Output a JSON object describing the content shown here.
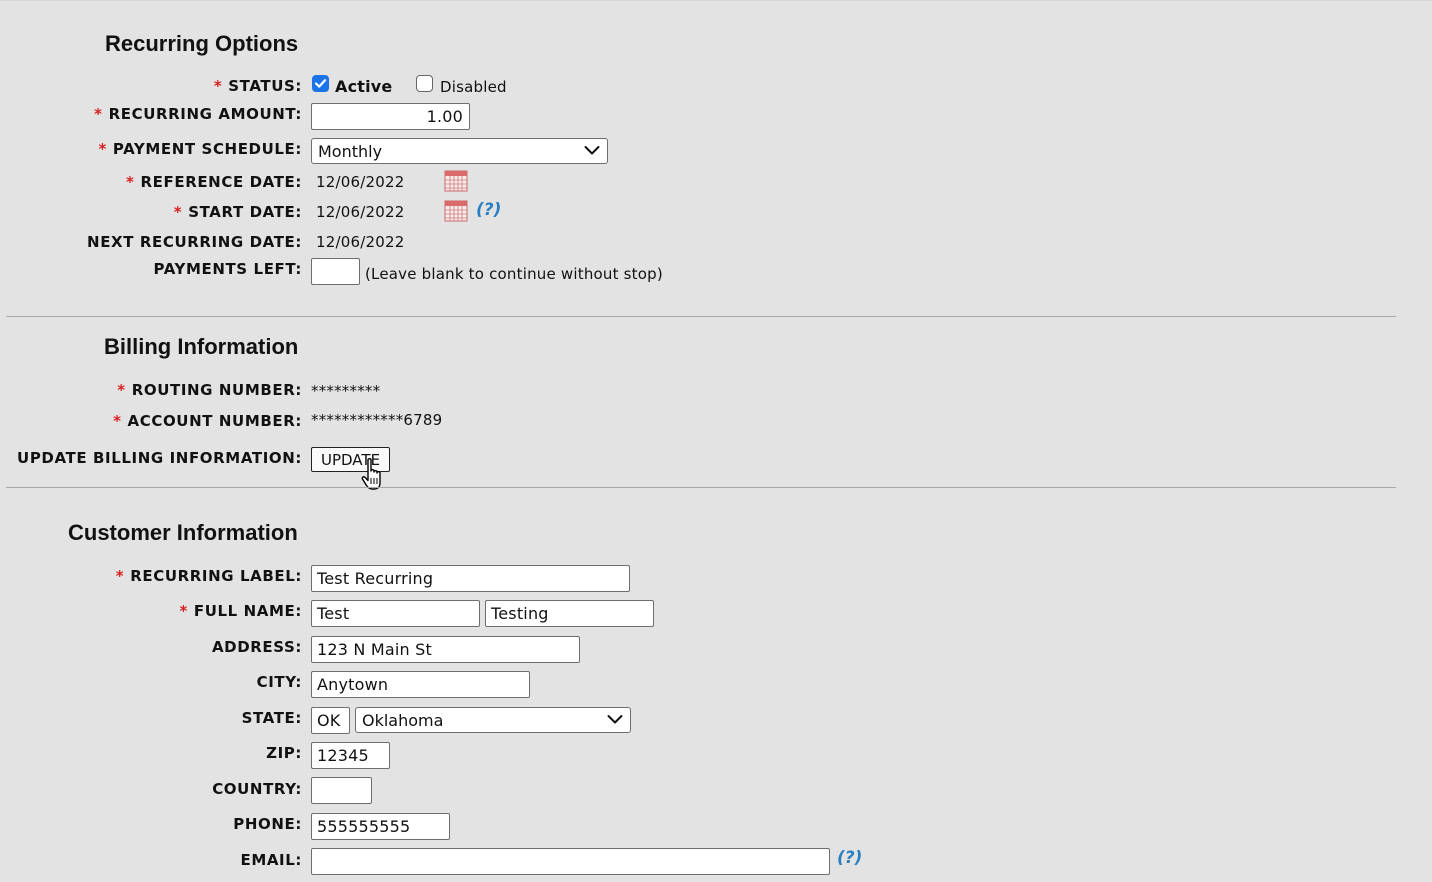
{
  "recurring": {
    "heading": "Recurring Options",
    "status": {
      "label": "STATUS:",
      "active_label": "Active",
      "active_checked": true,
      "disabled_label": "Disabled",
      "disabled_checked": false
    },
    "amount": {
      "label": "RECURRING AMOUNT:",
      "value": "1.00"
    },
    "schedule": {
      "label": "PAYMENT SCHEDULE:",
      "value": "Monthly"
    },
    "reference_date": {
      "label": "REFERENCE DATE:",
      "value": "12/06/2022"
    },
    "start_date": {
      "label": "START DATE:",
      "value": "12/06/2022",
      "help": "(?)"
    },
    "next_date": {
      "label": "NEXT RECURRING DATE:",
      "value": "12/06/2022"
    },
    "payments_left": {
      "label": "PAYMENTS LEFT:",
      "value": "",
      "hint": "(Leave blank to continue without stop)"
    }
  },
  "billing": {
    "heading": "Billing Information",
    "routing": {
      "label": "ROUTING NUMBER:",
      "value": "*********"
    },
    "account": {
      "label": "ACCOUNT NUMBER:",
      "value": "************6789"
    },
    "update": {
      "label": "UPDATE BILLING INFORMATION:",
      "button": "UPDATE"
    }
  },
  "customer": {
    "heading": "Customer Information",
    "recurring_label": {
      "label": "RECURRING LABEL:",
      "value": "Test Recurring"
    },
    "full_name": {
      "label": "FULL NAME:",
      "first": "Test",
      "last": "Testing"
    },
    "address": {
      "label": "ADDRESS:",
      "value": "123 N Main St"
    },
    "city": {
      "label": "CITY:",
      "value": "Anytown"
    },
    "state": {
      "label": "STATE:",
      "code": "OK",
      "name": "Oklahoma"
    },
    "zip": {
      "label": "ZIP:",
      "value": "12345"
    },
    "country": {
      "label": "COUNTRY:",
      "value": ""
    },
    "phone": {
      "label": "PHONE:",
      "value": "555555555"
    },
    "email": {
      "label": "EMAIL:",
      "value": "",
      "help": "(?)"
    }
  },
  "required_marker": "*",
  "colors": {
    "background": "#e3e3e3",
    "required": "#d91f1f",
    "help": "#2a7fc4",
    "checkbox": "#1a73e8"
  },
  "icons": {
    "calendar": "calendar-icon",
    "dropdown": "chevron-down-icon",
    "cursor": "hand-pointer-icon"
  }
}
